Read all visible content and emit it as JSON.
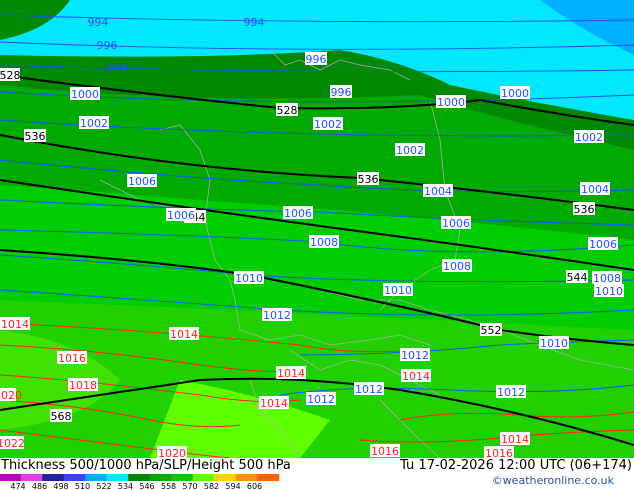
{
  "title": "Thickness 500/1000 hPa/SLP/Height 500 hPa",
  "valid_time": "Tu 17-02-2026 12:00 UTC (06+174)",
  "credit": "©weatheronline.co.uk",
  "legend": {
    "ticks": [
      "474",
      "486",
      "498",
      "510",
      "522",
      "534",
      "546",
      "558",
      "570",
      "582",
      "594",
      "606"
    ],
    "colors": [
      "#c000c0",
      "#e040e0",
      "#2020a0",
      "#4040ff",
      "#00b0ff",
      "#00e8ff",
      "#008800",
      "#00aa00",
      "#00cc00",
      "#60ff00",
      "#ffd000",
      "#ff9000",
      "#ff6000"
    ]
  },
  "thickness_labels": [
    "528",
    "528",
    "528",
    "536",
    "536",
    "536",
    "544",
    "544",
    "552",
    "568"
  ],
  "slp_labels": [
    "994",
    "994",
    "996",
    "998",
    "996",
    "996",
    "1000",
    "1000",
    "1000",
    "1002",
    "1002",
    "1002",
    "1002",
    "1004",
    "1004",
    "1006",
    "1006",
    "1006",
    "1006",
    "1006",
    "1008",
    "1008",
    "1008",
    "1010",
    "1010",
    "1010",
    "1010",
    "1012",
    "1012",
    "1012",
    "1012",
    "1012",
    "1014",
    "1014",
    "1014",
    "1014",
    "1014",
    "1014",
    "1016",
    "1016",
    "1016",
    "1018",
    "1020",
    "1020",
    "1022"
  ],
  "colors": {
    "cyan": "#00e8ff",
    "dark_green": "#008800",
    "green": "#00aa00",
    "bright_green": "#00cc00",
    "lime": "#60ff00",
    "slp_blue": "#2050ff",
    "slp_red": "#ff2020",
    "thickness": "#000000",
    "border": "#aaaaaa"
  }
}
